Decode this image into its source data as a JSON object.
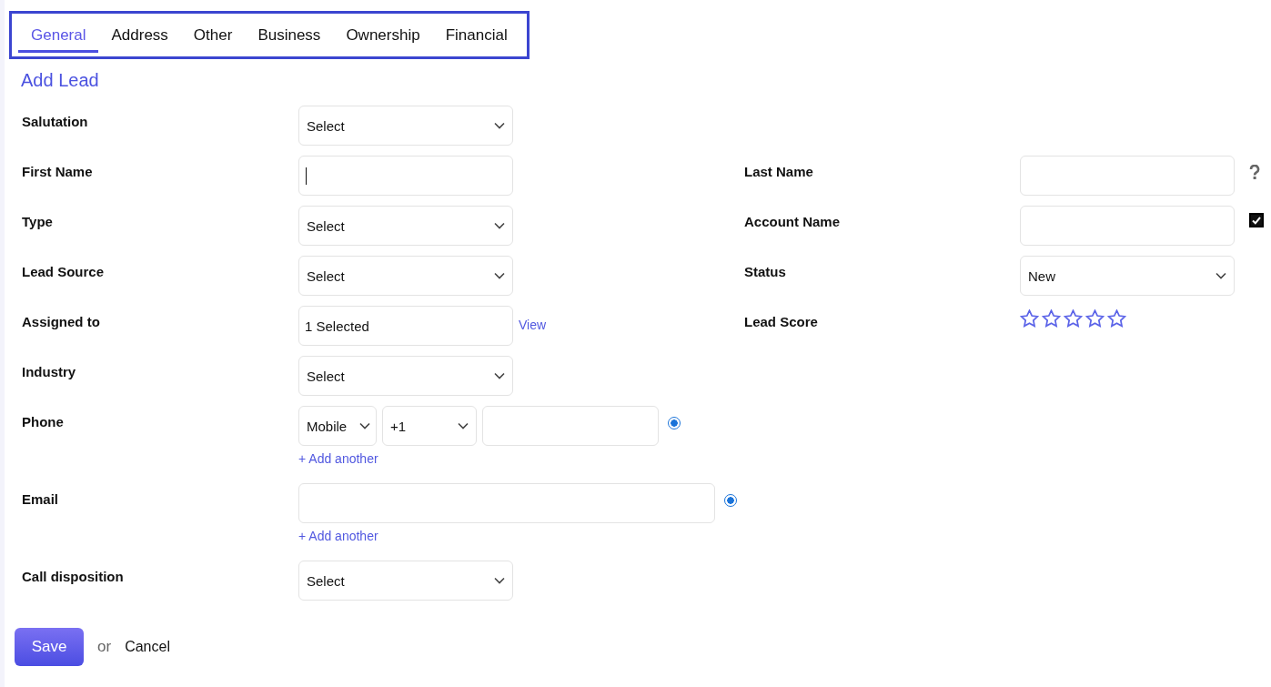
{
  "tabs": [
    {
      "label": "General",
      "selected": true
    },
    {
      "label": "Address",
      "selected": false
    },
    {
      "label": "Other",
      "selected": false
    },
    {
      "label": "Business",
      "selected": false
    },
    {
      "label": "Ownership",
      "selected": false
    },
    {
      "label": "Financial",
      "selected": false
    }
  ],
  "title": "Add Lead",
  "rows": [
    {
      "fields": [
        {
          "label": "Salutation",
          "kind": "select",
          "value": "Select"
        }
      ]
    },
    {
      "fields": [
        {
          "label": "First Name",
          "kind": "text",
          "focused": true
        },
        {
          "label": "Last Name",
          "kind": "text",
          "focused": false,
          "help": true
        }
      ]
    },
    {
      "fields": [
        {
          "label": "Type",
          "kind": "select",
          "value": "Select"
        },
        {
          "label": "Account Name",
          "kind": "text",
          "focused": false,
          "checked": true
        }
      ]
    },
    {
      "fields": [
        {
          "label": "Lead Source",
          "kind": "select",
          "value": "Select"
        },
        {
          "label": "Status",
          "kind": "select",
          "value": "New"
        }
      ]
    },
    {
      "fields": [
        {
          "label": "Assigned to",
          "kind": "multi",
          "value": "1 Selected",
          "link": "View"
        },
        {
          "label": "Lead Score",
          "kind": "stars",
          "stars": 0
        }
      ]
    },
    {
      "fields": [
        {
          "label": "Industry",
          "kind": "select",
          "value": "Select"
        }
      ]
    },
    {
      "fields": [
        {
          "label": "Phone",
          "kind": "phone",
          "type": "Mobile",
          "code": "+1",
          "primary": true,
          "add": "+ Add another"
        }
      ]
    },
    {
      "fields": [
        {
          "label": "Email",
          "kind": "email",
          "primary": true,
          "add": "+ Add another"
        }
      ]
    },
    {
      "fields": [
        {
          "label": "Call disposition",
          "kind": "select",
          "value": "Select"
        }
      ]
    }
  ],
  "actions": {
    "save": "Save",
    "separator": "or",
    "cancel": "Cancel"
  }
}
